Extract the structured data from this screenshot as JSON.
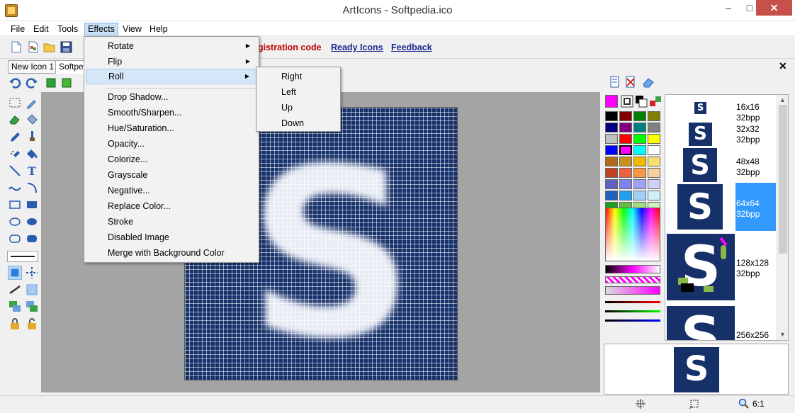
{
  "window": {
    "title": "ArtIcons - Softpedia.ico"
  },
  "menubar": {
    "items": [
      "File",
      "Edit",
      "Tools",
      "Effects",
      "View",
      "Help"
    ]
  },
  "toolbar": {
    "links": [
      "gistration code",
      "Ready Icons",
      "Feedback"
    ]
  },
  "tabs": {
    "items": [
      "New Icon 1",
      "Softpe"
    ]
  },
  "effects_menu": {
    "items": [
      {
        "label": "Rotate",
        "submenu": true
      },
      {
        "label": "Flip",
        "submenu": true
      },
      {
        "label": "Roll",
        "submenu": true
      },
      {
        "label": "Drop Shadow..."
      },
      {
        "label": "Smooth/Sharpen..."
      },
      {
        "label": "Hue/Saturation..."
      },
      {
        "label": "Opacity..."
      },
      {
        "label": "Colorize..."
      },
      {
        "label": "Grayscale"
      },
      {
        "label": "Negative..."
      },
      {
        "label": "Replace Color..."
      },
      {
        "label": "Stroke"
      },
      {
        "label": "Disabled Image"
      },
      {
        "label": "Merge with Background Color"
      }
    ]
  },
  "roll_submenu": {
    "items": [
      "Right",
      "Left",
      "Up",
      "Down"
    ]
  },
  "icon_list": {
    "items": [
      {
        "size": "16x16",
        "bpp": "32bpp"
      },
      {
        "size": "32x32",
        "bpp": "32bpp"
      },
      {
        "size": "48x48",
        "bpp": "32bpp"
      },
      {
        "size": "64x64",
        "bpp": "32bpp"
      },
      {
        "size": "128x128",
        "bpp": "32bpp"
      },
      {
        "size": "256x256",
        "bpp": ""
      }
    ]
  },
  "canvas": {
    "letter": "S"
  },
  "status": {
    "zoom": "6:1"
  },
  "colors": {
    "canvas_bg": "#16306a",
    "selection": "#3399ff",
    "link": "#1b2a8c",
    "link_alert": "#c40000"
  }
}
